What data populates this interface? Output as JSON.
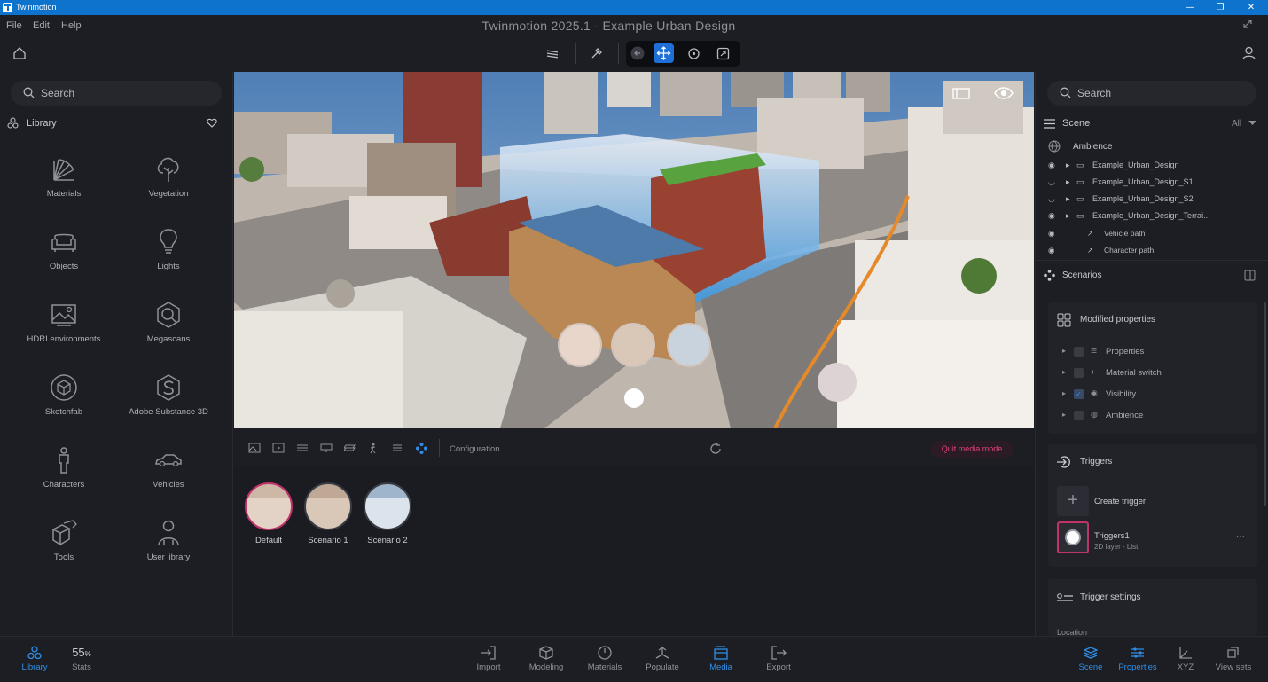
{
  "window": {
    "app_name": "Twinmotion",
    "title": "Twinmotion 2025.1 - Example Urban Design"
  },
  "menu": [
    "File",
    "Edit",
    "Help"
  ],
  "library": {
    "search_placeholder": "Search",
    "header": "Library",
    "items": [
      {
        "label": "Materials",
        "icon": "materials-icon"
      },
      {
        "label": "Vegetation",
        "icon": "tree-icon"
      },
      {
        "label": "Objects",
        "icon": "sofa-icon"
      },
      {
        "label": "Lights",
        "icon": "lightbulb-icon"
      },
      {
        "label": "HDRI environments",
        "icon": "hdri-icon"
      },
      {
        "label": "Megascans",
        "icon": "megascans-icon"
      },
      {
        "label": "Sketchfab",
        "icon": "sketchfab-icon"
      },
      {
        "label": "Adobe Substance 3D",
        "icon": "substance-icon"
      },
      {
        "label": "Characters",
        "icon": "character-icon"
      },
      {
        "label": "Vehicles",
        "icon": "car-icon"
      },
      {
        "label": "Tools",
        "icon": "tools-icon"
      },
      {
        "label": "User library",
        "icon": "user-library-icon"
      }
    ]
  },
  "media": {
    "configuration_label": "Configuration",
    "quit_label": "Quit media mode",
    "scenarios": [
      {
        "label": "Default",
        "selected": true
      },
      {
        "label": "Scenario 1",
        "selected": false
      },
      {
        "label": "Scenario 2",
        "selected": false
      }
    ]
  },
  "scene_panel": {
    "search_placeholder": "Search",
    "header": "Scene",
    "filter": "All",
    "ambience": "Ambience",
    "tree": [
      {
        "label": "Example_Urban_Design",
        "visible": true,
        "folder": true
      },
      {
        "label": "Example_Urban_Design_S1",
        "visible": false,
        "folder": true
      },
      {
        "label": "Example_Urban_Design_S2",
        "visible": false,
        "folder": true
      },
      {
        "label": "Example_Urban_Design_Terrai...",
        "visible": true,
        "folder": true
      },
      {
        "label": "Vehicle path",
        "visible": true,
        "folder": false
      },
      {
        "label": "Character path",
        "visible": true,
        "folder": false
      }
    ]
  },
  "scenarios_panel": {
    "header": "Scenarios",
    "modified_header": "Modified properties",
    "properties": [
      {
        "label": "Properties",
        "checked": false
      },
      {
        "label": "Material switch",
        "checked": false
      },
      {
        "label": "Visibility",
        "checked": true
      },
      {
        "label": "Ambience",
        "checked": false
      }
    ],
    "triggers_header": "Triggers",
    "create_trigger": "Create trigger",
    "trigger_name": "Triggers1",
    "trigger_sub": "2D layer - List",
    "trigger_settings": "Trigger settings",
    "location": "Location"
  },
  "footer": {
    "library": "Library",
    "stats_value": "55",
    "stats_unit": "%",
    "stats": "Stats",
    "tabs": [
      "Import",
      "Modeling",
      "Materials",
      "Populate",
      "Media",
      "Export"
    ],
    "right_tabs": [
      "Scene",
      "Properties",
      "XYZ",
      "View sets"
    ]
  },
  "colors": {
    "accent": "#2f8fe8",
    "title_bar": "#0e73cc",
    "highlight": "#e0437a"
  }
}
